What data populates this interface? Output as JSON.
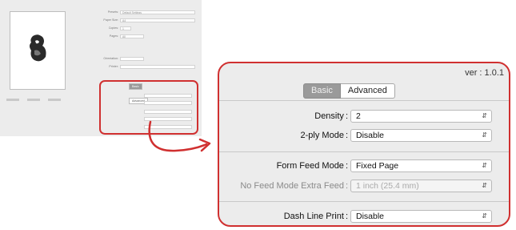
{
  "thumbnail": {
    "rows": [
      {
        "label": "Presets:",
        "value": "Default Settings"
      },
      {
        "label": "Paper Size:",
        "value": "A4"
      },
      {
        "label": "Copies:",
        "value": "1"
      },
      {
        "label": "Pages:",
        "value": "All"
      },
      {
        "label": "Orientation:",
        "value": ""
      },
      {
        "label": "Printer:",
        "value": ""
      }
    ],
    "segment": {
      "basic": "Basic",
      "advanced": "Advanced"
    }
  },
  "panel": {
    "version": "ver : 1.0.1",
    "tabs": {
      "basic": "Basic",
      "advanced": "Advanced"
    },
    "fields": {
      "density": {
        "label": "Density",
        "value": "2"
      },
      "two_ply": {
        "label": "2-ply Mode",
        "value": "Disable"
      },
      "form_feed": {
        "label": "Form Feed Mode",
        "value": "Fixed Page"
      },
      "no_feed_extra": {
        "label": "No Feed Mode Extra Feed",
        "value": "1 inch (25.4 mm)"
      },
      "dash_line": {
        "label": "Dash Line Print",
        "value": "Disable"
      }
    },
    "colon": ":"
  },
  "colors": {
    "highlight": "#d03030",
    "panel_bg": "#ececec",
    "active_tab": "#9a9a9a"
  }
}
